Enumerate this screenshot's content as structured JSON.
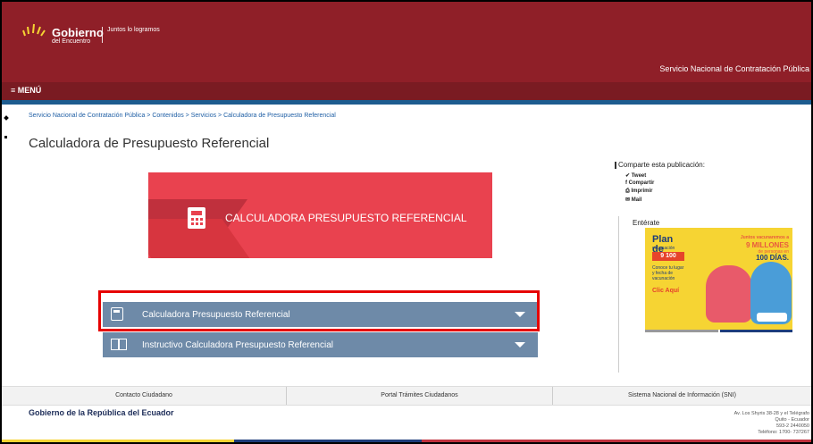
{
  "header": {
    "brand_line1": "Gobierno",
    "brand_line2": "del Encuentro",
    "tagline": "Juntos lo logramos",
    "site_name": "Servicio Nacional de Contratación Pública",
    "menu_label": "≡ MENÚ"
  },
  "breadcrumb": "Servicio Nacional de Contratación Pública > Contenidos > Servicios > Calculadora de Presupuesto Referencial",
  "page_title": "Calculadora de Presupuesto Referencial",
  "hero": {
    "title": "CALCULADORA PRESUPUESTO REFERENCIAL"
  },
  "accordion": [
    {
      "label": "Calculadora Presupuesto Referencial"
    },
    {
      "label": "Instructivo Calculadora Presupuesto Referencial"
    }
  ],
  "share": {
    "heading": "Comparte esta publicación:",
    "items": [
      "Tweet",
      "Compartir",
      "Imprimir",
      "Mail"
    ]
  },
  "enterate": "Entérate",
  "ad": {
    "plan": "Plan de",
    "plan_sub": "vacunación",
    "numbers": "9 100",
    "line1": "Juntos vacunaremos a",
    "line2": "9 MILLONES",
    "line3": "de personas en",
    "line4": "100 DÍAS.",
    "small": "Conoce tu lugar y fecha de vacunación",
    "cta": "Clic Aquí"
  },
  "footer": {
    "links": [
      "Contacto Ciudadano",
      "Portal Trámites Ciudadanos",
      "Sistema Nacional de Información (SNI)"
    ],
    "org": "Gobierno de la República del Ecuador",
    "address": [
      "Av. Los Shyris 38-28 y el Telégrafo",
      "Quito - Ecuador",
      "593-2 2440050",
      "Teléfono: 1700- 737267"
    ]
  },
  "colors": {
    "header": "#8f1f28",
    "accent_blue": "#1d5c8f",
    "hero": "#e9424f",
    "accordion": "#6e8aa8",
    "highlight": "#e60000"
  }
}
